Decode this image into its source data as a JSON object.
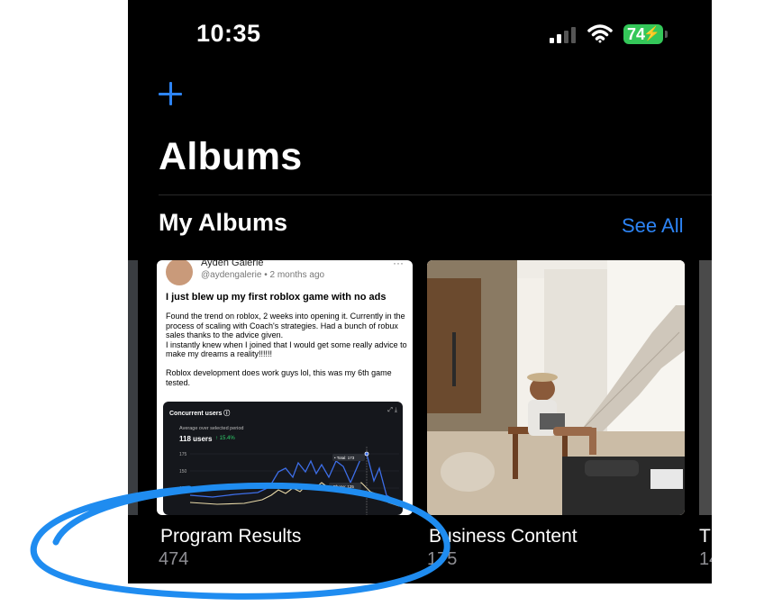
{
  "status_bar": {
    "time": "10:35",
    "battery": "74"
  },
  "page": {
    "title": "Albums"
  },
  "section": {
    "title": "My Albums",
    "see_all": "See All"
  },
  "albums": [
    {
      "title": "Program Results",
      "count": "474"
    },
    {
      "title": "Business Content",
      "count": "175"
    },
    {
      "title": "T",
      "count": "14"
    }
  ],
  "post": {
    "author": "Ayden Galerie",
    "meta": "@aydengalerie • 2 months ago",
    "menu": "···",
    "headline": "I just blew up my first roblox game with no ads",
    "body": "Found the trend on roblox, 2 weeks into opening it. Currently in the process of scaling with Coach's strategies. Had a bunch of robux sales thanks to the advice given.\nI instantly knew when I joined that I would get some really advice to make my dreams a reality!!!!!!\n\nRoblox development does work guys lol, this was my 6th game tested.",
    "panel": {
      "title": "Concurrent users ⓘ",
      "subtitle": "Average over selected period",
      "users": "118 users",
      "delta": "↑ 15.4%",
      "y_ticks": [
        "175",
        "150",
        "125"
      ],
      "tooltips": [
        "• Total: 173",
        "• Phone: 125"
      ],
      "tools": "⤢ ⤓"
    }
  },
  "colors": {
    "accent": "#2d84f5",
    "annotation": "#1f8cf0",
    "battery": "#34c759"
  },
  "icons": [
    "plus-icon",
    "cellular-signal-icon",
    "wifi-icon",
    "battery-icon",
    "charging-bolt-icon"
  ]
}
